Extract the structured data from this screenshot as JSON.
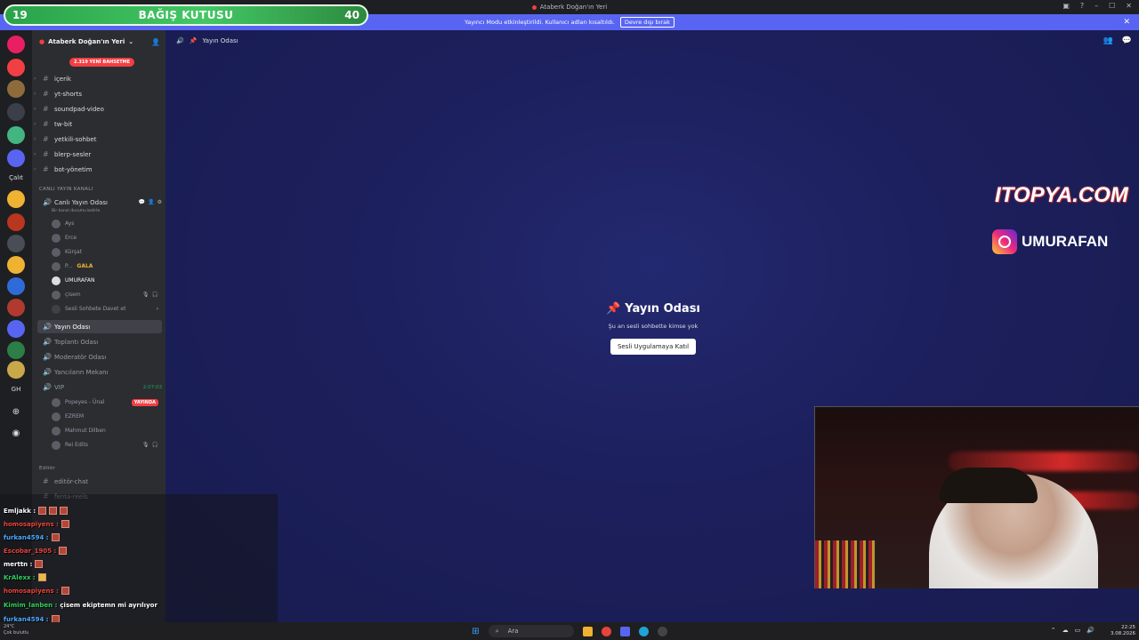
{
  "window": {
    "title": "Ataberk Doğan'ın Yeri"
  },
  "notice": {
    "text": "Yayıncı Modu etkinleştirildi. Kullanıcı adları kısaltıldı.",
    "button": "Devre dışı bırak"
  },
  "donation": {
    "left": "19",
    "title": "BAĞIŞ KUTUSU",
    "right": "40"
  },
  "rail": {
    "text_cat": "Çalıt",
    "text_gh": "GH"
  },
  "server": {
    "name": "Ataberk Doğan'ın Yeri",
    "new_messages": "2.319 YENİ BAHSETME"
  },
  "channels": {
    "icerik": "içerik",
    "yt_shorts": "yt-shorts",
    "soundpad": "soundpad-video",
    "tw_bit": "tw-bit",
    "yetkili": "yetkili-sohbet",
    "blerp": "blerp-sesler",
    "bot": "bot-yönetim"
  },
  "live_category": "CANLI YAYIN KANALI",
  "live_channel": {
    "name": "Canlı Yayın Odası",
    "status": "Bir kanal durumu belirle"
  },
  "voice_users": [
    "Ays",
    "Erce",
    "Kürşat",
    "P...",
    "UMURAFAN",
    "çisem"
  ],
  "gala_tag": "GALA",
  "invite_text": "Sesli Sohbete Davet et",
  "voice_channels": {
    "yayin": "Yayın Odası",
    "toplanti": "Toplantı Odası",
    "moderator": "Moderatör Odası",
    "yancilar": "Yancıların Mekanı",
    "vip": "VIP"
  },
  "vip_time": "2:07:03",
  "vip_users": [
    "Popeyes - Ünal",
    "EZREM",
    "Mahmut Dilben",
    "Rei Edits"
  ],
  "live_label": "YAYINDA",
  "editor_category": "Editör",
  "editor_channels": {
    "chat": "editör-chat",
    "reels": "fenta-reels"
  },
  "main": {
    "header_title": "Yayın Odası",
    "center_title": "Yayın Odası",
    "center_sub": "Şu an sesli sohbette kimse yok",
    "join_button": "Sesli Uygulamaya Katıl"
  },
  "overlay": {
    "sponsor": "ITOPYA.COM",
    "instagram": "UMURAFAN"
  },
  "chat": [
    {
      "nick": "Emljakk :",
      "color": "#ffffff"
    },
    {
      "nick": "homosapiyens :",
      "color": "#e8433a"
    },
    {
      "nick": "furkan4594 :",
      "color": "#4aa8ff"
    },
    {
      "nick": "Escobar_1905 :",
      "color": "#e8433a"
    },
    {
      "nick": "merttn :",
      "color": "#ffffff"
    },
    {
      "nick": "KrAlexx :",
      "color": "#2fd05a"
    },
    {
      "nick": "homosapiyens :",
      "color": "#e8433a"
    },
    {
      "nick": "Kimim_lanben :",
      "color": "#2fd05a",
      "message": "çisem ekiptemn mi ayrılıyor"
    },
    {
      "nick": "furkan4594 :",
      "color": "#4aa8ff"
    }
  ],
  "taskbar": {
    "search": "Ara",
    "weather_temp": "24°C",
    "weather": "Çok bulutlu",
    "time": "22:25",
    "date": "3.08.2026"
  },
  "colors": {
    "blurple": "#5865f2",
    "live": "#f23f43",
    "online": "#23a55a"
  }
}
